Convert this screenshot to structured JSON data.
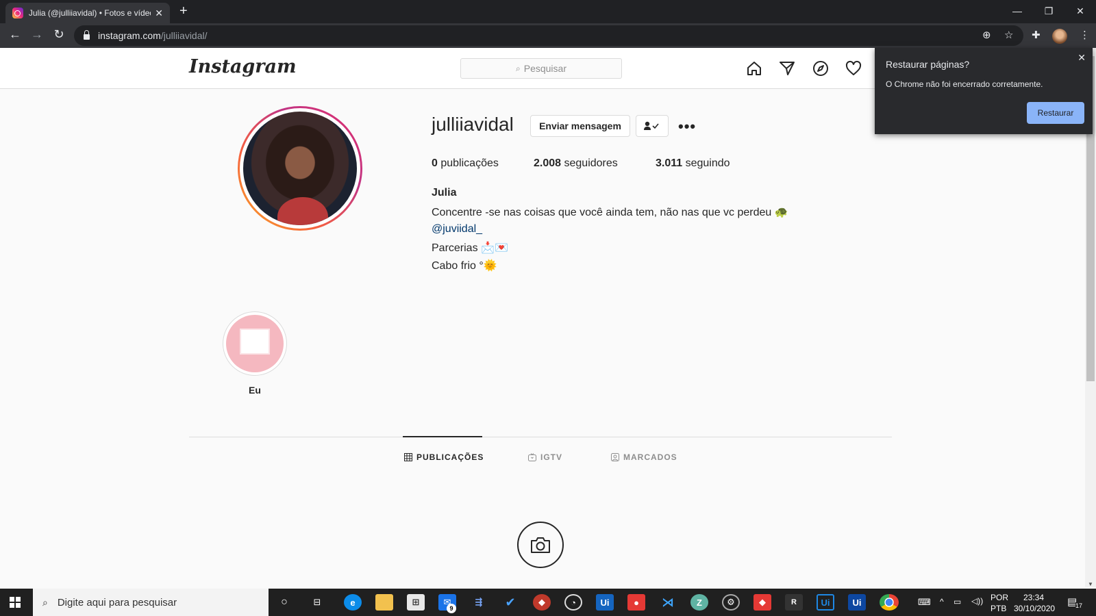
{
  "browser": {
    "tab_title": "Julia (@julliiavidal) • Fotos e vídeos",
    "tab_close": "✕",
    "new_tab": "+",
    "url_host": "instagram.com",
    "url_path": "/julliiavidal/",
    "window_controls": [
      "—",
      "❐",
      "✕"
    ]
  },
  "instagram": {
    "logo": "Instagram",
    "search_placeholder": "Pesquisar",
    "profile": {
      "username": "julliiavidal",
      "message_button": "Enviar mensagem",
      "more": "•••",
      "stats": {
        "posts_count": "0",
        "posts_label": "publicações",
        "followers_count": "2.008",
        "followers_label": "seguidores",
        "following_count": "3.011",
        "following_label": "seguindo"
      },
      "bio": {
        "name": "Julia",
        "line1": "Concentre -se nas coisas que você ainda tem, não nas que vc perdeu 🐢",
        "mention": "@juviidal_",
        "line3": "Parcerias 📩💌",
        "line4": "Cabo frio °🌞"
      }
    },
    "highlight": {
      "label": "Eu"
    },
    "tabs": [
      {
        "label": "PUBLICAÇÕES",
        "icon": "grid-icon",
        "active": true
      },
      {
        "label": "IGTV",
        "icon": "igtv-icon",
        "active": false
      },
      {
        "label": "MARCADOS",
        "icon": "tagged-icon",
        "active": false
      }
    ]
  },
  "restore_popup": {
    "title": "Restaurar páginas?",
    "text": "O Chrome não foi encerrado corretamente.",
    "button": "Restaurar",
    "close": "✕"
  },
  "taskbar": {
    "search_placeholder": "Digite aqui para pesquisar",
    "mail_badge": "9",
    "lang_top": "POR",
    "lang_bottom": "PTB",
    "time": "23:34",
    "date": "30/10/2020",
    "notifications": "17"
  },
  "colors": {
    "chrome_dark": "#202124",
    "chrome_tab": "#35363a",
    "ig_text": "#262626",
    "ig_muted": "#8e8e8e",
    "ig_link": "#00376b",
    "popup_button": "#8ab4f8"
  }
}
